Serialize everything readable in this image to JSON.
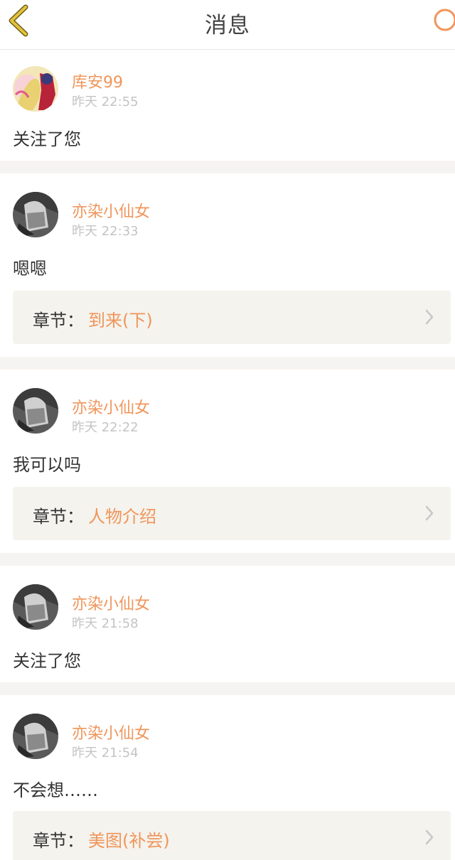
{
  "header": {
    "title": "消息",
    "back_icon": "chevron-left-icon",
    "search_icon": "search-icon",
    "back_color": "#d9b51a",
    "search_color": "#f0955a"
  },
  "chapter_label": "章节：",
  "messages": [
    {
      "user": "库安99",
      "time": "昨天 22:55",
      "text": "关注了您"
    },
    {
      "user": "亦染小仙女",
      "time": "昨天 22:33",
      "text": "嗯嗯",
      "chapter": "到来(下)"
    },
    {
      "user": "亦染小仙女",
      "time": "昨天 22:22",
      "text": "我可以吗",
      "chapter": "人物介绍"
    },
    {
      "user": "亦染小仙女",
      "time": "昨天 21:58",
      "text": "关注了您"
    },
    {
      "user": "亦染小仙女",
      "time": "昨天 21:54",
      "text": "不会想……",
      "chapter": "美图(补尝)"
    }
  ],
  "colors": {
    "accent": "#f0955a",
    "divider": "#f6f4f2",
    "chapter_bg": "#f4f3ee"
  }
}
